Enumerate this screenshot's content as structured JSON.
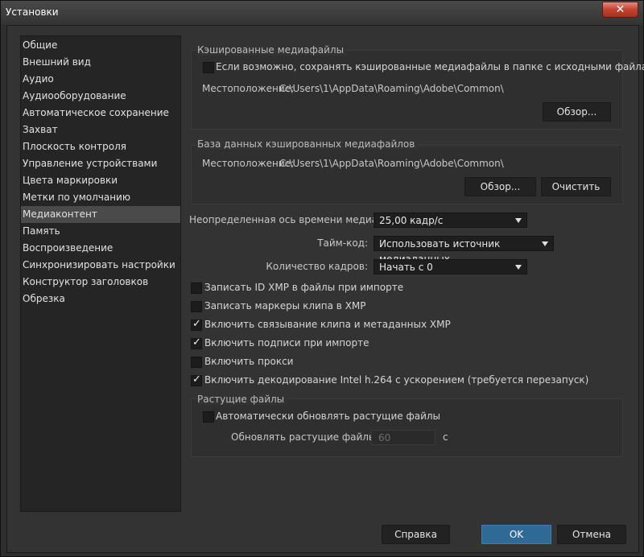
{
  "window": {
    "title": "Установки",
    "close_glyph": "✕"
  },
  "sidebar": {
    "items": [
      {
        "label": "Общие"
      },
      {
        "label": "Внешний вид"
      },
      {
        "label": "Аудио"
      },
      {
        "label": "Аудиооборудование"
      },
      {
        "label": "Автоматическое сохранение"
      },
      {
        "label": "Захват"
      },
      {
        "label": "Плоскость контроля"
      },
      {
        "label": "Управление устройствами"
      },
      {
        "label": "Цвета маркировки"
      },
      {
        "label": "Метки по умолчанию"
      },
      {
        "label": "Медиаконтент"
      },
      {
        "label": "Память"
      },
      {
        "label": "Воспроизведение"
      },
      {
        "label": "Синхронизировать настройки"
      },
      {
        "label": "Конструктор заголовков"
      },
      {
        "label": "Обрезка"
      }
    ],
    "selected_index": 10
  },
  "cached_media": {
    "title": "Кэшированные медиафайлы",
    "checkbox_label": "Если возможно, сохранять кэшированные медиафайлы в папке с исходными файлами",
    "checked": false,
    "location_label": "Местоположение:",
    "location_value": "C:\\Users\\1\\AppData\\Roaming\\Adobe\\Common\\",
    "browse_label": "Обзор..."
  },
  "cache_db": {
    "title": "База данных кэшированных медиафайлов",
    "location_label": "Местоположение:",
    "location_value": "C:\\Users\\1\\AppData\\Roaming\\Adobe\\Common\\",
    "browse_label": "Обзор...",
    "clean_label": "Очистить"
  },
  "settings": {
    "timebase_label": "Неопределенная ось времени медиаданных:",
    "timebase_value": "25,00 кадр/с",
    "timecode_label": "Тайм-код:",
    "timecode_value": "Использовать источник медиаданных",
    "framecount_label": "Количество кадров:",
    "framecount_value": "Начать с 0"
  },
  "options": [
    {
      "label": "Записать ID XMP в файлы при импорте",
      "checked": false
    },
    {
      "label": "Записать маркеры клипа в XMP",
      "checked": false
    },
    {
      "label": "Включить связывание клипа и метаданных XMP",
      "checked": true
    },
    {
      "label": "Включить подписи при импорте",
      "checked": true
    },
    {
      "label": "Включить прокси",
      "checked": false
    },
    {
      "label": "Включить декодирование Intel h.264 с ускорением (требуется перезапуск)",
      "checked": true
    }
  ],
  "growing_files": {
    "title": "Растущие файлы",
    "auto_label": "Автоматически обновлять растущие файлы",
    "auto_checked": false,
    "refresh_label": "Обновлять растущие файлы раз в",
    "refresh_value": "60",
    "unit": "с"
  },
  "footer": {
    "help_label": "Справка",
    "ok_label": "OK",
    "cancel_label": "Отмена"
  },
  "check_glyph": "✓"
}
